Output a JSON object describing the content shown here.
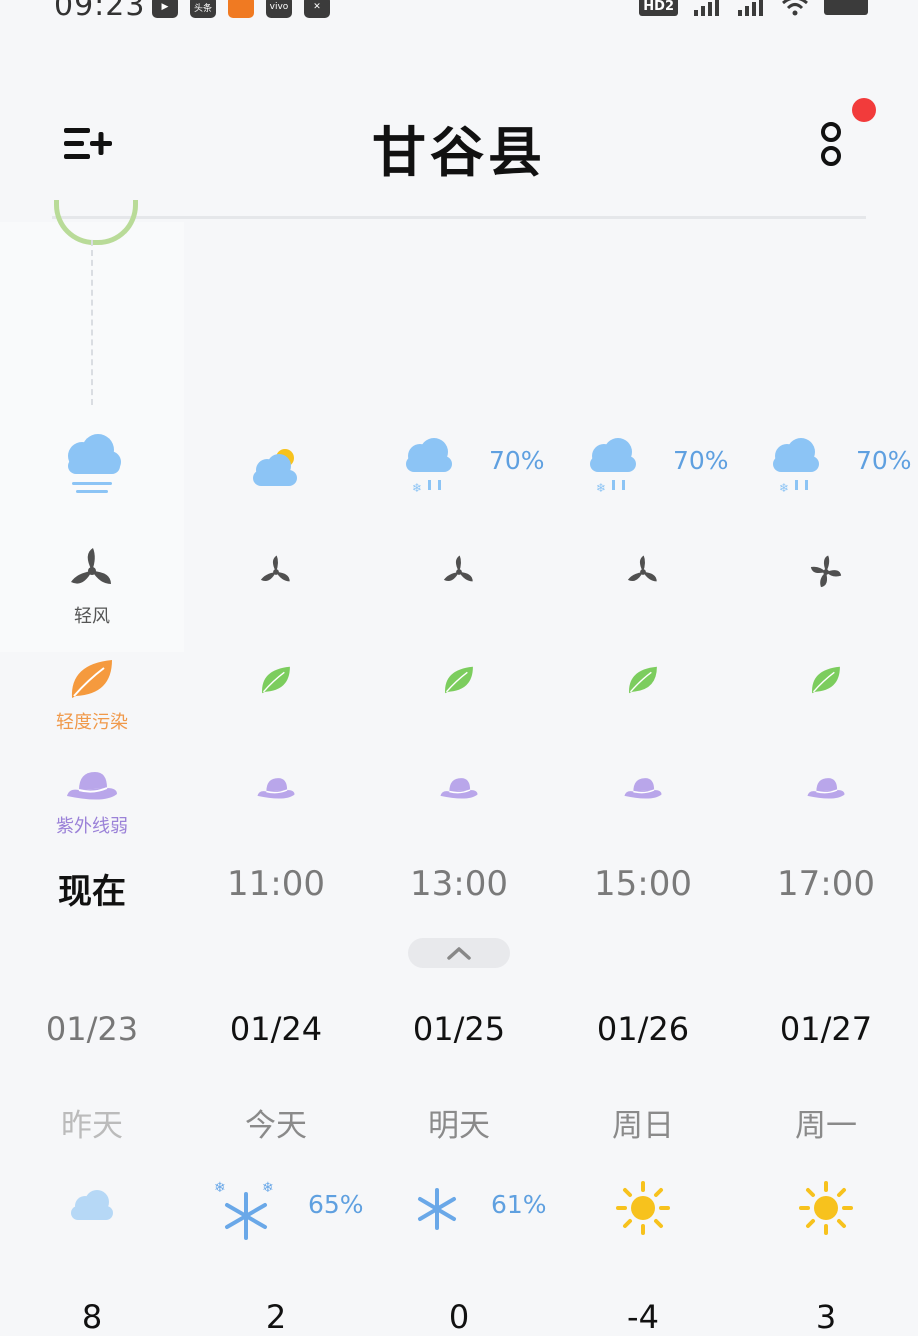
{
  "status": {
    "time": "09:23",
    "apps": [
      "▶",
      "头条",
      "",
      "vivo",
      "✕"
    ],
    "hd": "HD2"
  },
  "header": {
    "city": "甘谷县"
  },
  "hourly": [
    {
      "time": "现在",
      "precip": "",
      "wind_label": "轻风",
      "air_label": "轻度污染",
      "uv_label": "紫外线弱"
    },
    {
      "time": "11:00",
      "precip": "",
      "wind_label": "",
      "air_label": "",
      "uv_label": ""
    },
    {
      "time": "13:00",
      "precip": "70%",
      "wind_label": "",
      "air_label": "",
      "uv_label": ""
    },
    {
      "time": "15:00",
      "precip": "70%",
      "wind_label": "",
      "air_label": "",
      "uv_label": ""
    },
    {
      "time": "17:00",
      "precip": "70%",
      "wind_label": "",
      "air_label": "",
      "uv_label": ""
    }
  ],
  "daily": [
    {
      "date": "01/23",
      "day": "昨天",
      "precip": "",
      "temp": "8"
    },
    {
      "date": "01/24",
      "day": "今天",
      "precip": "65%",
      "temp": "2"
    },
    {
      "date": "01/25",
      "day": "明天",
      "precip": "61%",
      "temp": "0"
    },
    {
      "date": "01/26",
      "day": "周日",
      "precip": "",
      "temp": "-4"
    },
    {
      "date": "01/27",
      "day": "周一",
      "precip": "",
      "temp": "3"
    }
  ],
  "colors": {
    "cloud": "#8cc4f5",
    "sun": "#f7c21d",
    "leaf_green": "#7ccd5e",
    "leaf_orange": "#f59a3e",
    "hat": "#b9a6ea",
    "fan": "#505050",
    "precip_text": "#5fa0e0"
  }
}
